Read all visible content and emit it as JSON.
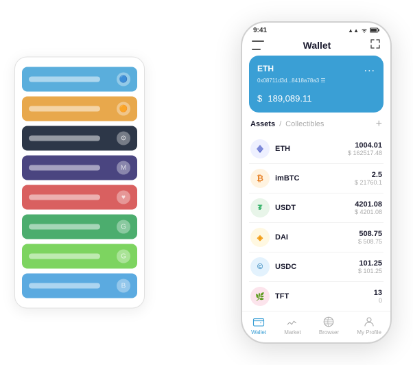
{
  "phone": {
    "status": {
      "time": "9:41",
      "icons": "▲▲ WiFi Batt"
    },
    "header": {
      "title": "Wallet",
      "menu_icon": "menu",
      "expand_icon": "⇲"
    },
    "eth_card": {
      "label": "ETH",
      "address": "0x08711d3d...8418a78a3  ☰",
      "balance_symbol": "$",
      "balance": "189,089.11",
      "dots": "..."
    },
    "assets": {
      "tab_active": "Assets",
      "separator": "/",
      "tab_inactive": "Collectibles",
      "add_icon": "+"
    },
    "asset_list": [
      {
        "symbol": "ETH",
        "logo_char": "◆",
        "logo_class": "logo-eth",
        "amount": "1004.01",
        "usd": "$ 162517.48"
      },
      {
        "symbol": "imBTC",
        "logo_char": "₿",
        "logo_class": "logo-imbtc",
        "amount": "2.5",
        "usd": "$ 21760.1"
      },
      {
        "symbol": "USDT",
        "logo_char": "₮",
        "logo_class": "logo-usdt",
        "amount": "4201.08",
        "usd": "$ 4201.08"
      },
      {
        "symbol": "DAI",
        "logo_char": "◈",
        "logo_class": "logo-dai",
        "amount": "508.75",
        "usd": "$ 508.75"
      },
      {
        "symbol": "USDC",
        "logo_char": "©",
        "logo_class": "logo-usdc",
        "amount": "101.25",
        "usd": "$ 101.25"
      },
      {
        "symbol": "TFT",
        "logo_char": "♥",
        "logo_class": "logo-tft",
        "amount": "13",
        "usd": "0"
      }
    ],
    "nav": [
      {
        "label": "Wallet",
        "active": true,
        "icon": "wallet"
      },
      {
        "label": "Market",
        "active": false,
        "icon": "market"
      },
      {
        "label": "Browser",
        "active": false,
        "icon": "browser"
      },
      {
        "label": "My Profile",
        "active": false,
        "icon": "profile"
      }
    ]
  },
  "card_stack": {
    "items": [
      {
        "color_class": "card-blue",
        "icon": "🔵"
      },
      {
        "color_class": "card-orange",
        "icon": "🟠"
      },
      {
        "color_class": "card-dark",
        "icon": "⚙"
      },
      {
        "color_class": "card-purple",
        "icon": "M"
      },
      {
        "color_class": "card-red",
        "icon": "❤"
      },
      {
        "color_class": "card-green",
        "icon": "G"
      },
      {
        "color_class": "card-lightgreen",
        "icon": "G"
      },
      {
        "color_class": "card-lightblue",
        "icon": "B"
      }
    ]
  }
}
